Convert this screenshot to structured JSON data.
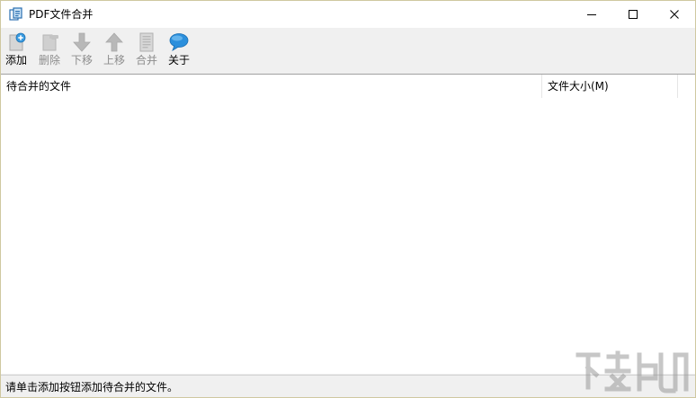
{
  "window": {
    "title": "PDF文件合并",
    "controls": {
      "minimize_icon": "minimize-icon",
      "maximize_icon": "maximize-icon",
      "close_icon": "close-icon"
    }
  },
  "toolbar": {
    "items": [
      {
        "label": "添加",
        "icon": "add-file-icon",
        "enabled": true
      },
      {
        "label": "删除",
        "icon": "delete-file-icon",
        "enabled": false
      },
      {
        "label": "下移",
        "icon": "arrow-down-icon",
        "enabled": false
      },
      {
        "label": "上移",
        "icon": "arrow-up-icon",
        "enabled": false
      },
      {
        "label": "合并",
        "icon": "merge-document-icon",
        "enabled": false
      },
      {
        "label": "关于",
        "icon": "speech-bubble-icon",
        "enabled": true
      }
    ]
  },
  "file_list": {
    "columns": [
      "待合并的文件",
      "文件大小(M)"
    ],
    "rows": []
  },
  "status_bar": {
    "text": "请单击添加按钮添加待合并的文件。"
  },
  "colors": {
    "window_border": "#cfc8a0",
    "toolbar_bg": "#f0f0f0",
    "list_bg": "#ffffff",
    "about_icon_blue": "#1e88d6",
    "disabled_icon_gray": "#b8b8b8"
  }
}
